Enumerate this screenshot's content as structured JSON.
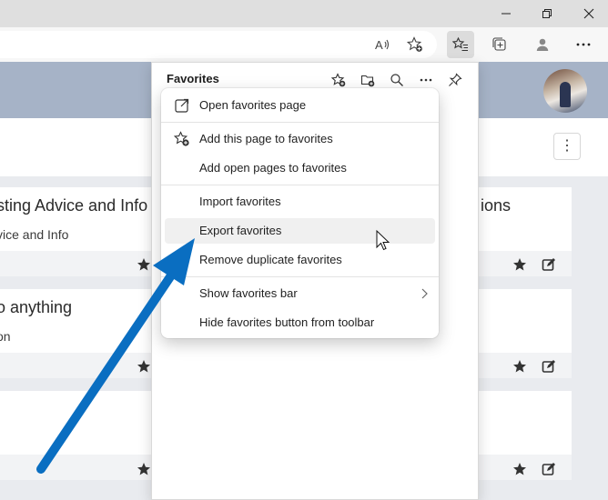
{
  "window": {
    "buttons": [
      "minimize",
      "restore",
      "close"
    ]
  },
  "toolbar": {
    "icons": [
      "read-aloud-icon",
      "add-favorite-icon",
      "favorites-icon",
      "collections-icon",
      "profile-icon",
      "more-icon"
    ]
  },
  "page": {
    "cards": [
      {
        "title": "sting Advice and Info",
        "subtitle": "vice and Info"
      },
      {
        "title": "o anything",
        "subtitle": "on"
      },
      {
        "title": "",
        "subtitle": ""
      }
    ],
    "right_card_title": "ions"
  },
  "favorites_panel": {
    "title": "Favorites"
  },
  "menu": {
    "items": [
      {
        "label": "Open favorites page",
        "icon": "open-external-icon"
      },
      {
        "label": "Add this page to favorites",
        "icon": "add-favorite-icon"
      },
      {
        "label": "Add open pages to favorites",
        "icon": ""
      },
      {
        "label": "Import favorites",
        "icon": ""
      },
      {
        "label": "Export favorites",
        "icon": ""
      },
      {
        "label": "Remove duplicate favorites",
        "icon": ""
      },
      {
        "label": "Show favorites bar",
        "icon": "chevron-right-icon"
      },
      {
        "label": "Hide favorites button from toolbar",
        "icon": ""
      }
    ],
    "hovered_item": "Export favorites"
  },
  "colors": {
    "arrow": "#0a6ec1",
    "header": "#a6b3c7",
    "hover": "#f0f0f0"
  }
}
